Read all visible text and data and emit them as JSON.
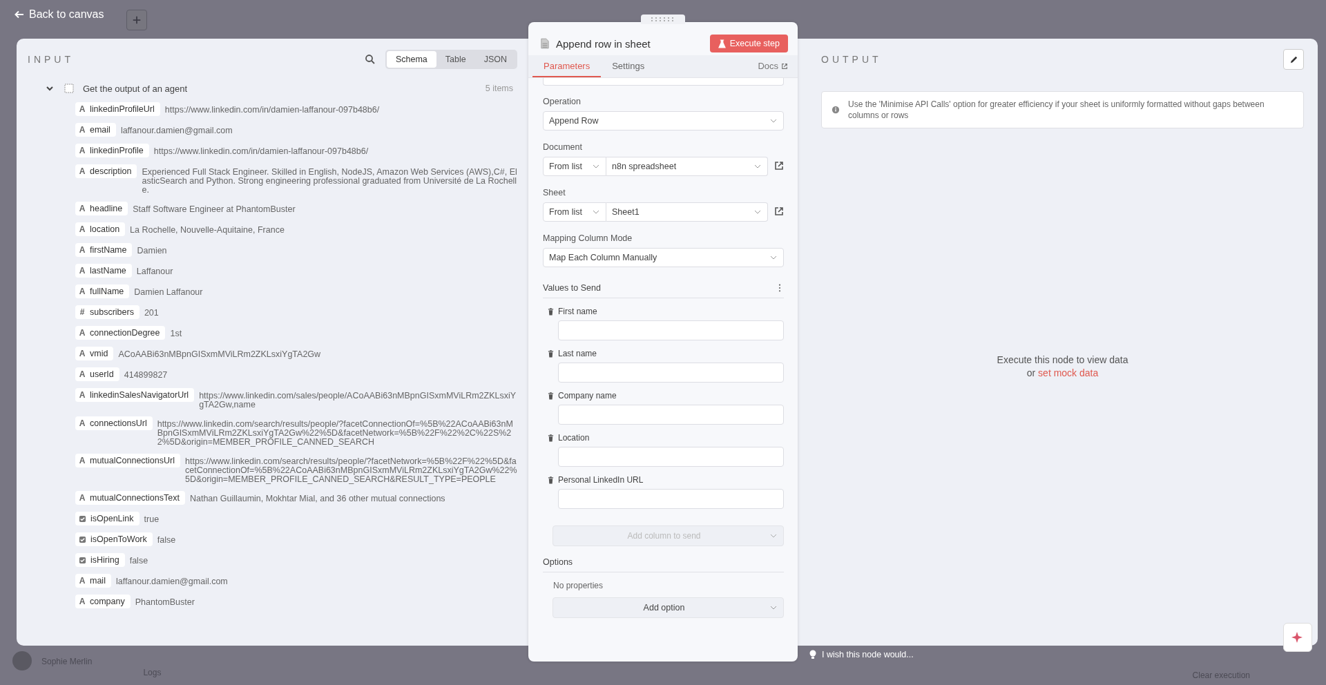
{
  "topbar": {
    "back": "Back to canvas"
  },
  "input": {
    "title": "INPUT",
    "views": [
      {
        "label": "Schema",
        "selected": true
      },
      {
        "label": "Table",
        "selected": false
      },
      {
        "label": "JSON",
        "selected": false
      }
    ],
    "node": {
      "name": "Get the output of an agent",
      "count": "5 items",
      "expanded": true
    },
    "fields": [
      {
        "kind": "string",
        "icon": "A",
        "key": "linkedinProfileUrl",
        "value": "https://www.linkedin.com/in/damien-laffanour-097b48b6/"
      },
      {
        "kind": "string",
        "icon": "A",
        "key": "email",
        "value": "laffanour.damien@gmail.com"
      },
      {
        "kind": "string",
        "icon": "A",
        "key": "linkedinProfile",
        "value": "https://www.linkedin.com/in/damien-laffanour-097b48b6/"
      },
      {
        "kind": "string",
        "icon": "A",
        "key": "description",
        "value": "Experienced Full Stack Engineer. Skilled in English, NodeJS, Amazon Web Services (AWS),C#, ElasticSearch and Python. Strong engineering professional graduated from Université de La Rochelle."
      },
      {
        "kind": "string",
        "icon": "A",
        "key": "headline",
        "value": "Staff Software Engineer at PhantomBuster"
      },
      {
        "kind": "string",
        "icon": "A",
        "key": "location",
        "value": "La Rochelle, Nouvelle-Aquitaine, France"
      },
      {
        "kind": "string",
        "icon": "A",
        "key": "firstName",
        "value": "Damien"
      },
      {
        "kind": "string",
        "icon": "A",
        "key": "lastName",
        "value": "Laffanour"
      },
      {
        "kind": "string",
        "icon": "A",
        "key": "fullName",
        "value": "Damien Laffanour"
      },
      {
        "kind": "number",
        "icon": "#",
        "key": "subscribers",
        "value": "201"
      },
      {
        "kind": "string",
        "icon": "A",
        "key": "connectionDegree",
        "value": "1st"
      },
      {
        "kind": "string",
        "icon": "A",
        "key": "vmid",
        "value": "ACoAABi63nMBpnGISxmMViLRm2ZKLsxiYgTA2Gw"
      },
      {
        "kind": "string",
        "icon": "A",
        "key": "userId",
        "value": "414899827"
      },
      {
        "kind": "string",
        "icon": "A",
        "key": "linkedinSalesNavigatorUrl",
        "value": "https://www.linkedin.com/sales/people/ACoAABi63nMBpnGISxmMViLRm2ZKLsxiYgTA2Gw,name"
      },
      {
        "kind": "string",
        "icon": "A",
        "key": "connectionsUrl",
        "value": "https://www.linkedin.com/search/results/people/?facetConnectionOf=%5B%22ACoAABi63nMBpnGISxmMViLRm2ZKLsxiYgTA2Gw%22%5D&facetNetwork=%5B%22F%22%2C%22S%22%5D&origin=MEMBER_PROFILE_CANNED_SEARCH"
      },
      {
        "kind": "string",
        "icon": "A",
        "key": "mutualConnectionsUrl",
        "value": "https://www.linkedin.com/search/results/people/?facetNetwork=%5B%22F%22%5D&facetConnectionOf=%5B%22ACoAABi63nMBpnGISxmMViLRm2ZKLsxiYgTA2Gw%22%5D&origin=MEMBER_PROFILE_CANNED_SEARCH&RESULT_TYPE=PEOPLE"
      },
      {
        "kind": "string",
        "icon": "A",
        "key": "mutualConnectionsText",
        "value": "Nathan Guillaumin, Mokhtar Mial, and 36 other mutual connections"
      },
      {
        "kind": "boolean",
        "key": "isOpenLink",
        "value": "true"
      },
      {
        "kind": "boolean",
        "key": "isOpenToWork",
        "value": "false"
      },
      {
        "kind": "boolean",
        "key": "isHiring",
        "value": "false"
      },
      {
        "kind": "string",
        "icon": "A",
        "key": "mail",
        "value": "laffanour.damien@gmail.com"
      },
      {
        "kind": "string",
        "icon": "A",
        "key": "company",
        "value": "PhantomBuster"
      }
    ]
  },
  "node_panel": {
    "title": "Append row in sheet",
    "execute": "Execute step",
    "tabs": [
      {
        "label": "Parameters",
        "selected": true
      },
      {
        "label": "Settings",
        "selected": false
      }
    ],
    "docs": "Docs",
    "operation": {
      "label": "Operation",
      "value": "Append Row"
    },
    "document": {
      "label": "Document",
      "mode": "From list",
      "value": "n8n spreadsheet"
    },
    "sheet": {
      "label": "Sheet",
      "mode": "From list",
      "value": "Sheet1"
    },
    "mapping": {
      "label": "Mapping Column Mode",
      "value": "Map Each Column Manually"
    },
    "values": {
      "label": "Values to Send",
      "columns": [
        "First name",
        "Last name",
        "Company name",
        "Location",
        "Personal LinkedIn URL"
      ],
      "add": "Add column to send"
    },
    "options": {
      "label": "Options",
      "empty": "No properties",
      "add": "Add option"
    }
  },
  "output": {
    "title": "OUTPUT",
    "notice": "Use the 'Minimise API Calls' option for greater efficiency if your sheet is uniformly formatted without gaps between columns or rows",
    "empty": "Execute this node to view data",
    "or": "or",
    "mock": "set mock data"
  },
  "feedback": "I wish this node would...",
  "background": {
    "user": "Sophie Merlin",
    "logs": "Logs",
    "clear": "Clear execution"
  }
}
